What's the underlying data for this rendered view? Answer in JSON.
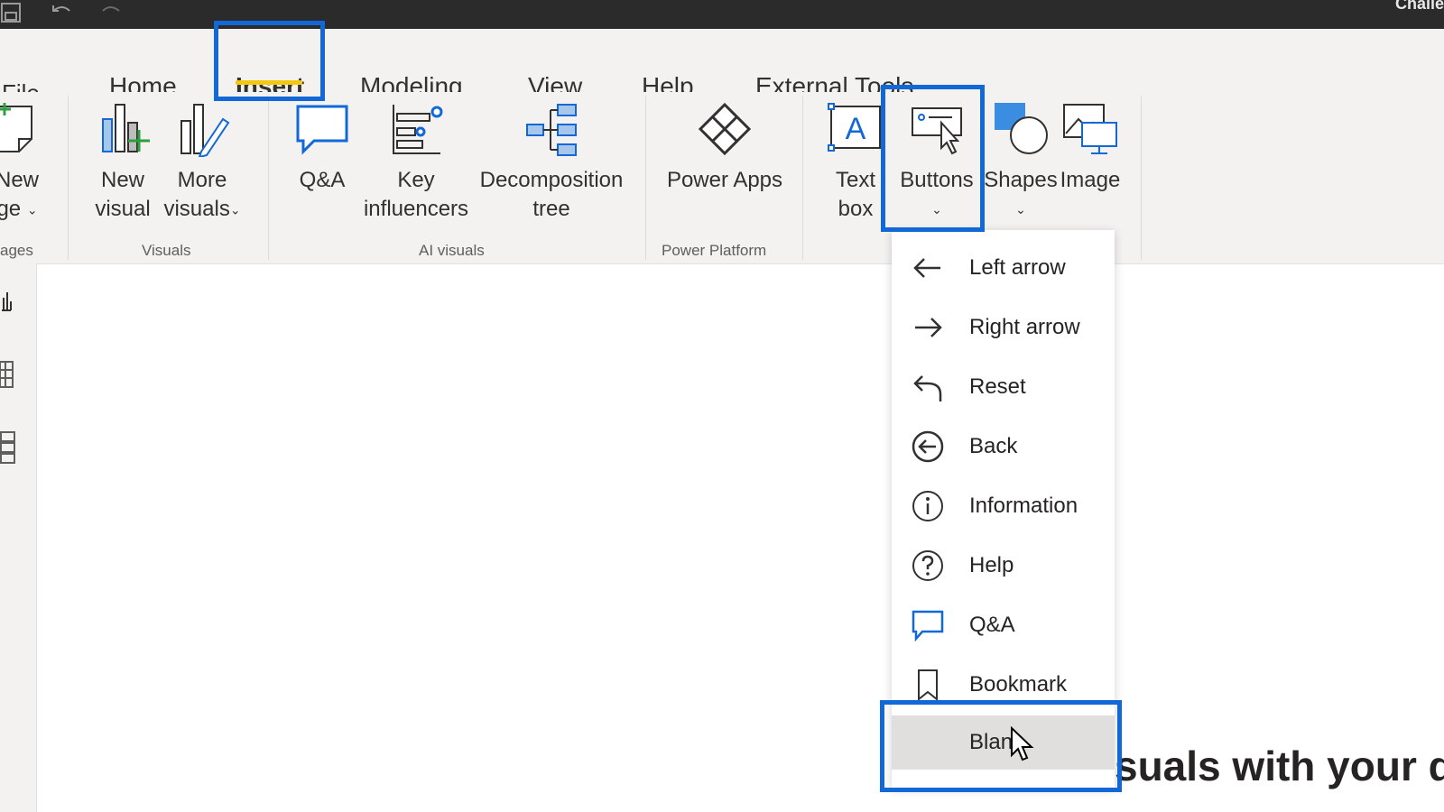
{
  "titlebar": {
    "user": "Challe"
  },
  "tabs": [
    {
      "label": "File"
    },
    {
      "label": "Home"
    },
    {
      "label": "Insert"
    },
    {
      "label": "Modeling"
    },
    {
      "label": "View"
    },
    {
      "label": "Help"
    },
    {
      "label": "External Tools"
    }
  ],
  "ribbon": {
    "new_page": {
      "line1": "New",
      "line2": "ge"
    },
    "new_visual": {
      "line1": "New",
      "line2": "visual"
    },
    "more_visuals": {
      "line1": "More",
      "line2": "visuals"
    },
    "qa": {
      "line1": "Q&A"
    },
    "key_influencers": {
      "line1": "Key",
      "line2": "influencers"
    },
    "decomposition_tree": {
      "line1": "Decomposition",
      "line2": "tree"
    },
    "power_apps": {
      "line1": "Power Apps"
    },
    "text_box": {
      "line1": "Text",
      "line2": "box"
    },
    "buttons": {
      "line1": "Buttons"
    },
    "shapes": {
      "line1": "Shapes"
    },
    "image": {
      "line1": "Image"
    }
  },
  "groups": {
    "pages": "ages",
    "visuals": "Visuals",
    "ai_visuals": "AI visuals",
    "power_platform": "Power Platform"
  },
  "buttons_menu": {
    "items": [
      {
        "label": "Left arrow",
        "icon": "left-arrow-icon"
      },
      {
        "label": "Right arrow",
        "icon": "right-arrow-icon"
      },
      {
        "label": "Reset",
        "icon": "reset-icon"
      },
      {
        "label": "Back",
        "icon": "back-circle-icon"
      },
      {
        "label": "Information",
        "icon": "information-icon"
      },
      {
        "label": "Help",
        "icon": "help-icon"
      },
      {
        "label": "Q&A",
        "icon": "qa-bubble-icon"
      },
      {
        "label": "Bookmark",
        "icon": "bookmark-icon"
      },
      {
        "label": "Blan",
        "icon": "none"
      }
    ]
  },
  "canvas": {
    "text": "suals with your d"
  },
  "colors": {
    "accent": "#1168d6",
    "insert_underline": "#f2c811",
    "menu_hover": "#e1dfdd"
  }
}
